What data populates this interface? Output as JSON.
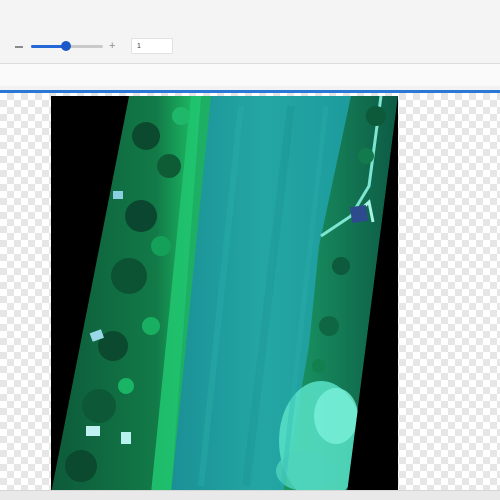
{
  "toolbar": {
    "zoom_minus_icon": "minus-icon",
    "zoom_plus_icon": "plus-icon",
    "zoom_plus_glyph": "+",
    "zoom_slider_fraction": 0.48,
    "zoom_input_value": "1"
  },
  "view_actions": {
    "layers_icon": "layers-icon",
    "undo_icon": "undo-icon"
  },
  "colors": {
    "accent": "#2467d6",
    "viewer_border": "#2a78d4",
    "nodata": "#000000",
    "river": "#1e9e9a",
    "vegetation": "#0f6b3c",
    "vegetation_bright": "#22d27a",
    "sediment": "#6ef0d8"
  }
}
